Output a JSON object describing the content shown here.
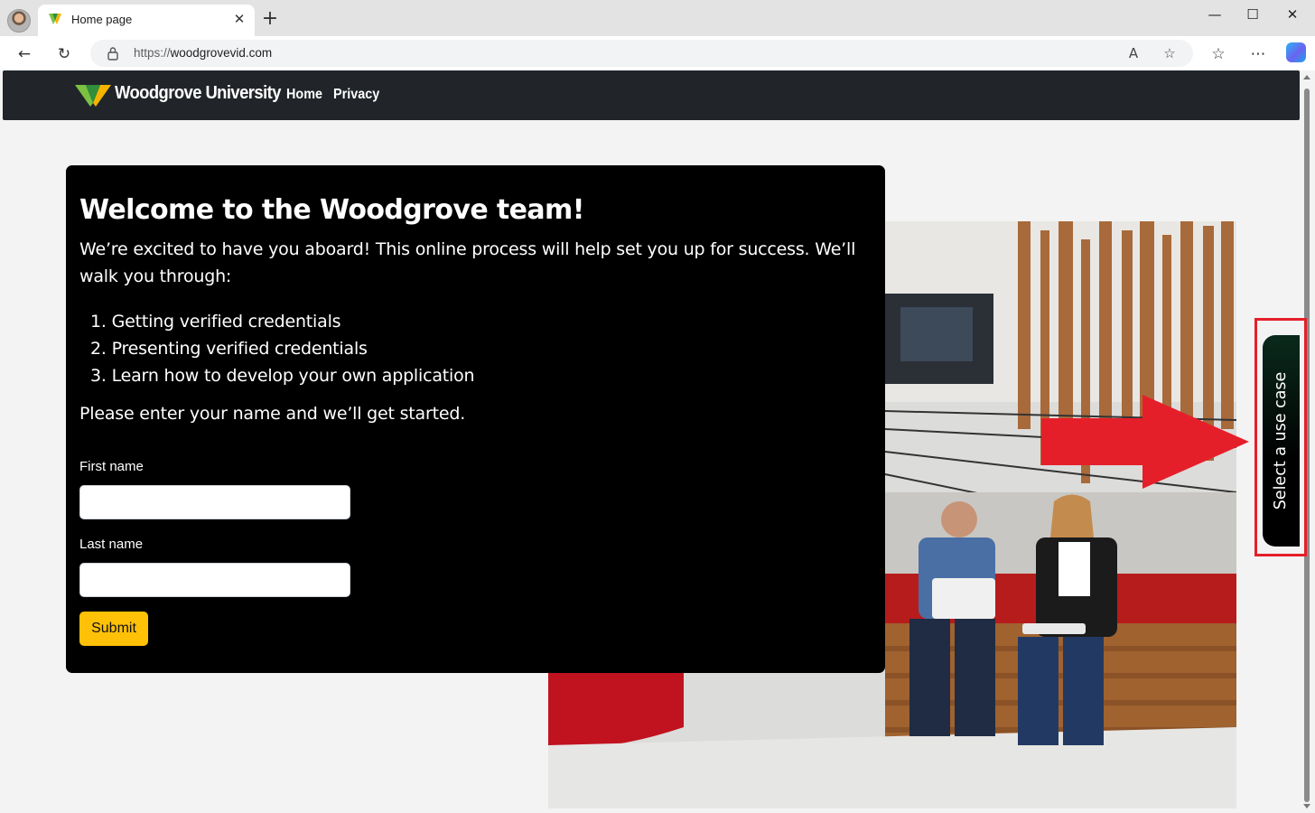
{
  "browser": {
    "tab_title": "Home page",
    "new_tab": "+",
    "url_protocol": "https://",
    "url_host": "woodgrovevid.com",
    "icons": [
      "back-icon",
      "refresh-icon",
      "lock-icon",
      "read-aloud-icon",
      "favorite-star-icon",
      "favorites-icon",
      "more-icon",
      "copilot-icon",
      "minimize-icon",
      "maximize-icon",
      "close-icon"
    ]
  },
  "navbar": {
    "brand": "Woodgrove University",
    "links": [
      "Home",
      "Privacy"
    ]
  },
  "card": {
    "title": "Welcome to the Woodgrove team!",
    "intro": "We’re excited to have you aboard! This online process will help set you up for success. We’ll walk you through:",
    "steps": [
      "1. Getting verified credentials",
      "2. Presenting verified credentials",
      "3. Learn how to develop your own application"
    ],
    "prompt": "Please enter your name and we’ll get started.",
    "first_name_label": "First name",
    "first_name_value": "",
    "last_name_label": "Last name",
    "last_name_value": "",
    "submit_label": "Submit"
  },
  "side_tab": {
    "label": "Select a use case"
  },
  "colors": {
    "navbar_bg": "#212529",
    "card_bg": "#000000",
    "submit_bg": "#ffc107",
    "annotation_red": "#e51f2a"
  }
}
